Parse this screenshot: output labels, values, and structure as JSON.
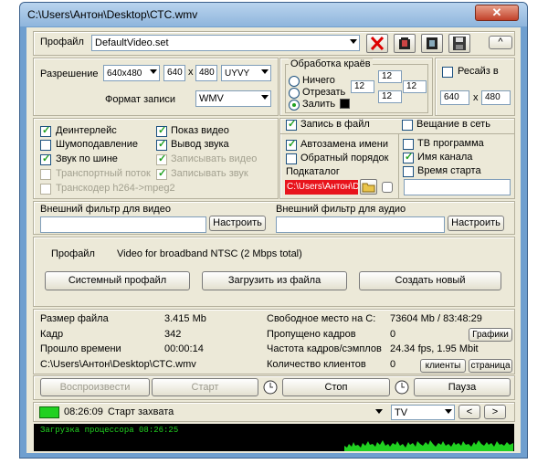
{
  "window": {
    "title": "C:\\Users\\Антон\\Desktop\\СТС.wmv",
    "close_glyph": "✕"
  },
  "profile": {
    "label": "Профайл",
    "value": "DefaultVideo.set",
    "up_glyph": "^"
  },
  "resolution": {
    "label": "Разрешение",
    "preset": "640x480",
    "width": "640",
    "x": "x",
    "height": "480",
    "colorspace": "UYVY",
    "format_label": "Формат записи",
    "format": "WMV"
  },
  "edges": {
    "title": "Обработка краёв",
    "options": [
      "Ничего",
      "Отрезать",
      "Залить"
    ],
    "fields": [
      "12",
      "12",
      "12",
      "12",
      "12",
      "12"
    ],
    "fill_color": "#000000"
  },
  "resize": {
    "label": "Ресайз в",
    "width": "640",
    "x": "x",
    "height": "480"
  },
  "options_left": [
    {
      "label": "Деинтерлейс",
      "checked": true,
      "disabled": false
    },
    {
      "label": "Показ видео",
      "checked": true,
      "disabled": false
    },
    {
      "label": "Шумоподавление",
      "checked": false,
      "disabled": false
    },
    {
      "label": "Вывод звука",
      "checked": true,
      "disabled": false
    },
    {
      "label": "Звук по шине",
      "checked": true,
      "disabled": false
    },
    {
      "label": "Записывать видео",
      "checked": true,
      "disabled": true
    },
    {
      "label": "Транспортный поток",
      "checked": false,
      "disabled": true
    },
    {
      "label": "Записывать звук",
      "checked": true,
      "disabled": true
    },
    {
      "label": "Транскодер h264->mpeg2",
      "checked": false,
      "disabled": true
    }
  ],
  "record": {
    "write_file": "Запись в файл",
    "broadcast": "Вещание в сеть",
    "auto_rename": "Автозамена имени",
    "reverse": "Обратный порядок",
    "tv_program": "ТВ программа",
    "channel_name": "Имя канала",
    "start_time": "Время старта",
    "subdir_label": "Подкаталог",
    "subdir_value": "C:\\Users\\Антон\\D"
  },
  "filters": {
    "video_label": "Внешний фильтр для видео",
    "audio_label": "Внешний фильтр для аудио",
    "configure": "Настроить"
  },
  "profile_info": {
    "label": "Профайл",
    "value": "Video for broadband NTSC (2 Mbps total)",
    "system": "Системный профайл",
    "load": "Загрузить из файла",
    "create": "Создать новый"
  },
  "stats": {
    "file_size_label": "Размер файла",
    "file_size": "3.415 Mb",
    "free_label": "Свободное место на C:",
    "free": "73604 Mb / 83:48:29",
    "frame_label": "Кадр",
    "frame": "342",
    "dropped_label": "Пропущено кадров",
    "dropped": "0",
    "graphs": "Графики",
    "elapsed_label": "Прошло времени",
    "elapsed": "00:00:14",
    "fps_label": "Частота кадров/сэмплов",
    "fps": "24.34 fps, 1.95 Mbit",
    "path": "C:\\Users\\Антон\\Desktop\\СТС.wmv",
    "clients_label": "Количество клиентов",
    "clients": "0",
    "clients_btn": "клиенты",
    "page_btn": "страница"
  },
  "controls": {
    "play": "Воспроизвести",
    "start": "Старт",
    "stop": "Стоп",
    "pause": "Пауза"
  },
  "status": {
    "time": "08:26:09",
    "message": "Старт захвата",
    "channel": "TV",
    "prev": "<",
    "next": ">",
    "indicator_color": "#21d121"
  },
  "log": {
    "text": "Загрузка процессора  08:26:25",
    "color": "#21d121"
  }
}
